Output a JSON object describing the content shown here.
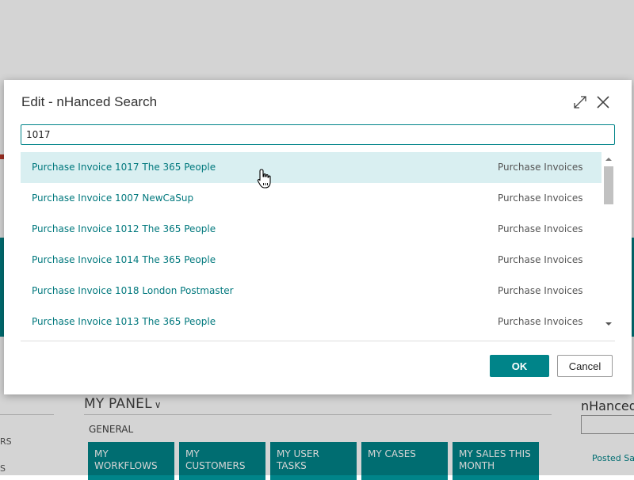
{
  "background": {
    "panel_title": "MY PANEL",
    "section_label": "GENERAL",
    "tiles": [
      "MY WORKFLOWS",
      "MY CUSTOMERS",
      "MY USER TASKS",
      "MY CASES",
      "MY SALES THIS MONTH"
    ],
    "left_text_1": "RS",
    "left_text_2": "S",
    "right_title": "nHanced",
    "right_link": "Posted Sa"
  },
  "dialog": {
    "title": "Edit - nHanced Search",
    "search": {
      "value": "1017"
    },
    "results": [
      {
        "title": "Purchase Invoice 1017 The 365 People",
        "category": "Purchase Invoices",
        "selected": true
      },
      {
        "title": "Purchase Invoice 1007 NewCaSup",
        "category": "Purchase Invoices",
        "selected": false
      },
      {
        "title": "Purchase Invoice 1012 The 365 People",
        "category": "Purchase Invoices",
        "selected": false
      },
      {
        "title": "Purchase Invoice 1014 The 365 People",
        "category": "Purchase Invoices",
        "selected": false
      },
      {
        "title": "Purchase Invoice 1018 London Postmaster",
        "category": "Purchase Invoices",
        "selected": false
      },
      {
        "title": "Purchase Invoice 1013 The 365 People",
        "category": "Purchase Invoices",
        "selected": false
      }
    ],
    "ok_label": "OK",
    "cancel_label": "Cancel"
  },
  "colors": {
    "accent": "#008489",
    "selected_row": "#d9eff1"
  }
}
